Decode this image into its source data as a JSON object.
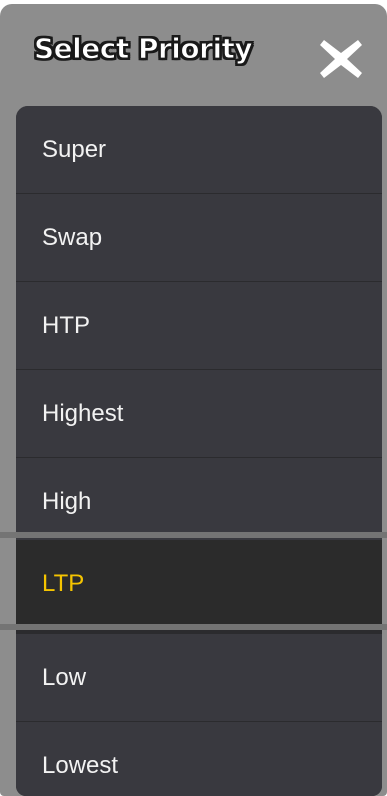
{
  "popup": {
    "title": "Select Priority",
    "close_icon": "close-x-icon"
  },
  "items": [
    {
      "label": "Super"
    },
    {
      "label": "Swap"
    },
    {
      "label": "HTP"
    },
    {
      "label": "Highest"
    },
    {
      "label": "High"
    },
    {
      "label": "LTP",
      "selected": true
    },
    {
      "label": "Low"
    },
    {
      "label": "Lowest"
    }
  ],
  "colors": {
    "selected_text": "#f5c400",
    "item_bg": "#39393f",
    "header_bg": "#8d8d8d"
  }
}
